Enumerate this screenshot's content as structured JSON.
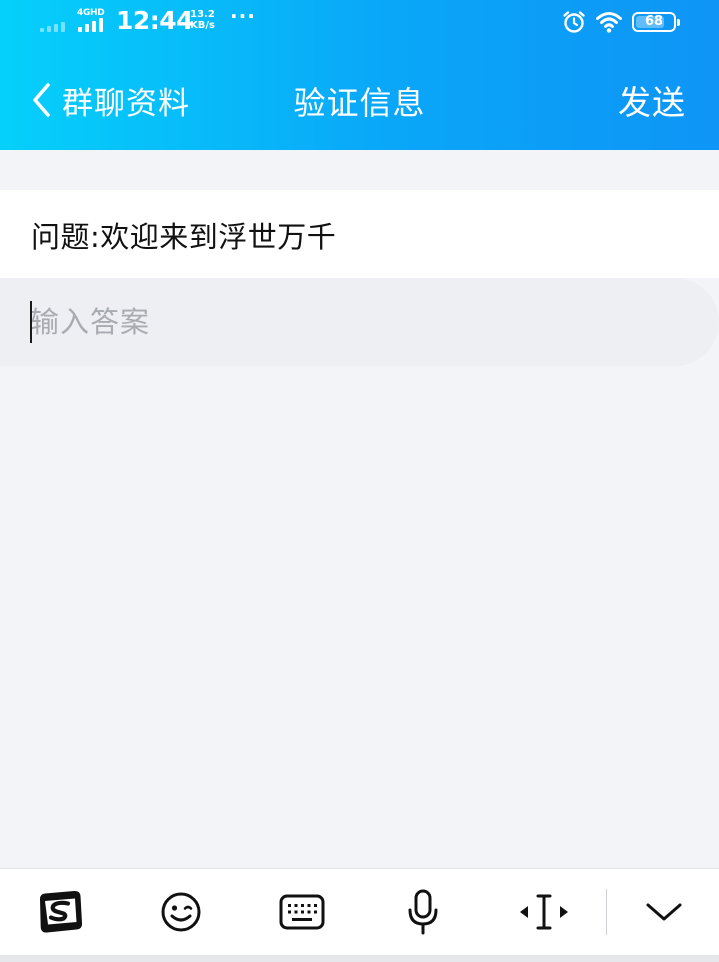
{
  "status_bar": {
    "network": "4GHD",
    "time": "12:44",
    "speed_value": "13.2",
    "speed_unit": "KB/s",
    "more": "···",
    "battery": "68"
  },
  "nav": {
    "back_label": "群聊资料",
    "title": "验证信息",
    "send_label": "发送"
  },
  "form": {
    "question": "问题:欢迎来到浮世万千",
    "answer_placeholder": "输入答案",
    "answer_value": ""
  },
  "keyboard_toolbar": {
    "items": [
      "sogou-logo-icon",
      "emoji-icon",
      "keyboard-icon",
      "microphone-icon",
      "cursor-move-icon",
      "chevron-down-icon"
    ]
  },
  "colors": {
    "header_start": "#05d0fb",
    "header_end": "#0e95f6",
    "page_bg": "#f3f4f8",
    "placeholder": "#a8abb2"
  }
}
